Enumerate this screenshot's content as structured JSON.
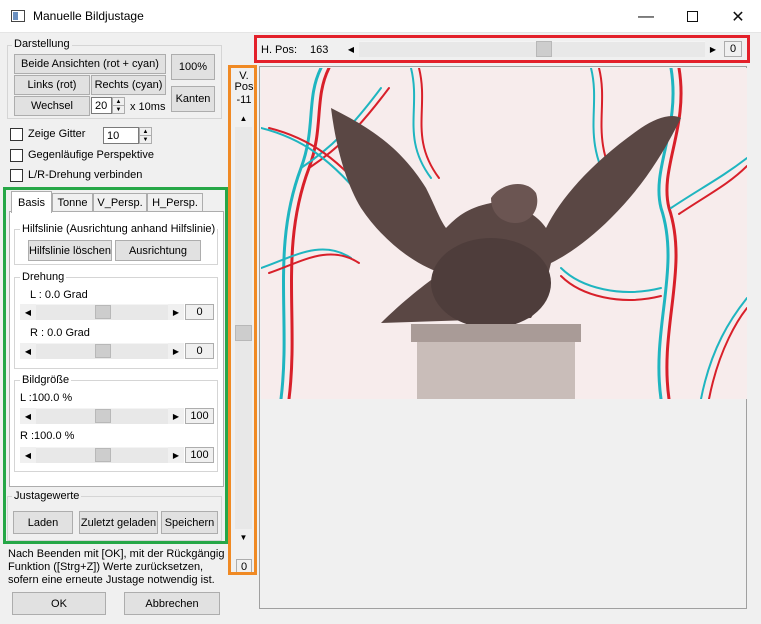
{
  "window": {
    "title": "Manuelle Bildjustage"
  },
  "darstellung": {
    "label": "Darstellung",
    "both_views": "Beide Ansichten (rot + cyan)",
    "zoom": "100%",
    "left": "Links (rot)",
    "right": "Rechts (cyan)",
    "edges": "Kanten",
    "toggle": "Wechsel",
    "interval_value": "20",
    "interval_unit": "x 10ms"
  },
  "options": {
    "show_grid": "Zeige Gitter",
    "grid_value": "10",
    "opposite_perspective": "Gegenläufige Perspektive",
    "link_rotation": "L/R-Drehung verbinden"
  },
  "tabs": [
    "Basis",
    "Tonne",
    "V_Persp.",
    "H_Persp."
  ],
  "basis": {
    "guideline_group": "Hilfslinie (Ausrichtung anhand Hilfslinie)",
    "delete_guideline": "Hilfslinie löschen",
    "align": "Ausrichtung",
    "rotation_group": "Drehung",
    "rot_left_label": "L : 0.0 Grad",
    "rot_left_value": "0",
    "rot_right_label": "R : 0.0 Grad",
    "rot_right_value": "0",
    "size_group": "Bildgröße",
    "size_left_label": "L :100.0 %",
    "size_left_value": "100",
    "size_right_label": "R :100.0 %",
    "size_right_value": "100"
  },
  "justage": {
    "label": "Justagewerte",
    "load": "Laden",
    "last_loaded": "Zuletzt geladen",
    "save": "Speichern"
  },
  "hint": {
    "line1": "Nach Beenden mit [OK], mit der Rückgängig",
    "line2": "Funktion ([Strg+Z]) Werte zurücksetzen,",
    "line3": "sofern eine erneute Justage notwendig ist."
  },
  "footer": {
    "ok": "OK",
    "cancel": "Abbrechen"
  },
  "hpos": {
    "label": "H. Pos:",
    "value": "163",
    "box": "0"
  },
  "vpos": {
    "label1": "V.",
    "label2": "Pos",
    "value": "-11",
    "box": "0"
  },
  "icons": {
    "app": "window-icon",
    "minimize": "minimize-icon",
    "maximize": "maximize-icon",
    "close": "close-icon",
    "left_arrow": "arrow-left-icon",
    "right_arrow": "arrow-right-icon",
    "up_arrow": "arrow-up-icon",
    "down_arrow": "arrow-down-icon"
  },
  "colors": {
    "highlight_red": "#e3202a",
    "highlight_orange": "#f08a24",
    "highlight_green": "#26a747",
    "anaglyph_red": "#d8202a",
    "anaglyph_cyan": "#1fb5c0"
  }
}
